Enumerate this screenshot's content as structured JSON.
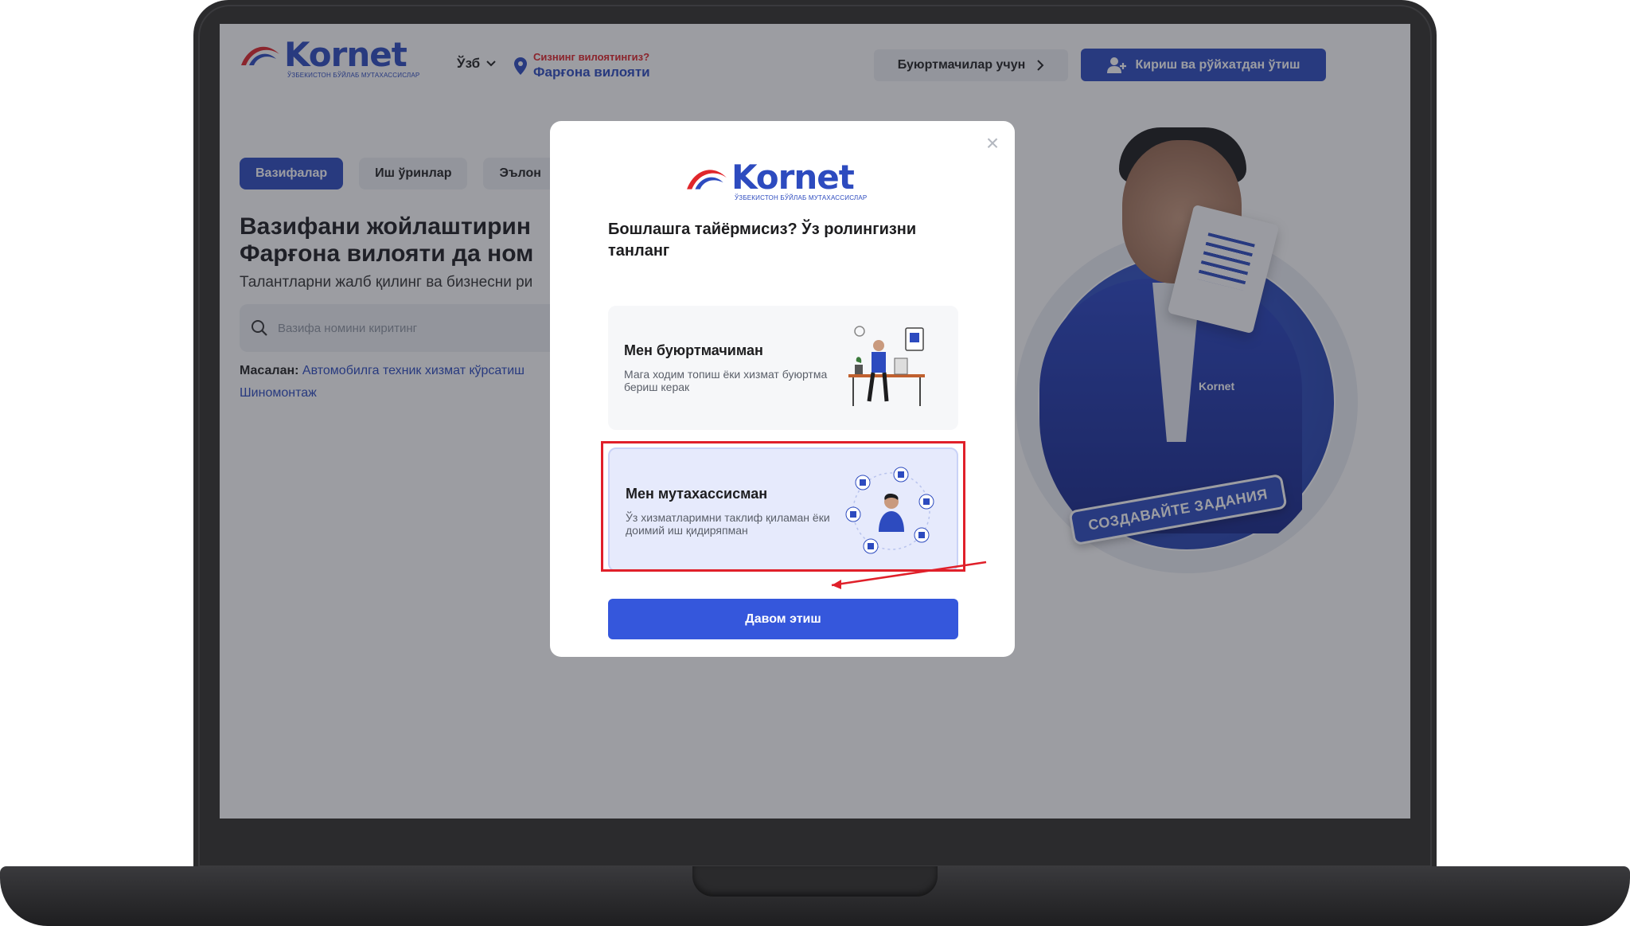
{
  "brand": {
    "name": "Kornet",
    "tagline": "ЎЗБЕКИСТОН БЎЙЛАБ МУТАХАССИСЛАР"
  },
  "header": {
    "language": "Ўзб",
    "region_question": "Сизнинг вилоятингиз?",
    "region_value": "Фарғона вилояти",
    "clients_button": "Буюртмачилар учун",
    "login_button": "Кириш ва рўйхатдан ўтиш"
  },
  "tabs": [
    {
      "label": "Вазифалар",
      "active": true
    },
    {
      "label": "Иш ўринлар",
      "active": false
    },
    {
      "label": "Эълон",
      "active": false
    }
  ],
  "hero": {
    "title_line1": "Вазифани жойлаштирин",
    "title_line2": "Фарғона вилояти да ном",
    "subtitle": "Талантларни жалб қилинг ва бизнесни ри",
    "search_placeholder": "Вазифа номини киритинг",
    "examples_label": "Масалан:",
    "example_1": "Автомобилга техник хизмат кўрсатиш",
    "example_2": "Шиномонтаж",
    "jacket_logo": "Kornet",
    "sticker_text": "СОЗДАВАЙТЕ ЗАДАНИЯ"
  },
  "modal": {
    "title": "Бошлашга тайёрмисиз? Ўз ролингизни танланг",
    "roles": [
      {
        "title": "Мен буюртмачиман",
        "description": "Мага ходим топиш ёки хизмат буюртма бериш керак",
        "selected": false
      },
      {
        "title": "Мен мутахассисман",
        "description": "Ўз хизматларимни таклиф қиламан ёки доимий иш қидиряпман",
        "selected": true
      }
    ],
    "continue_button": "Давом этиш"
  },
  "colors": {
    "brand_blue": "#2d4bbf",
    "button_blue": "#3557dc",
    "accent_red": "#e0202a",
    "selected_card": "#e6eafc"
  }
}
